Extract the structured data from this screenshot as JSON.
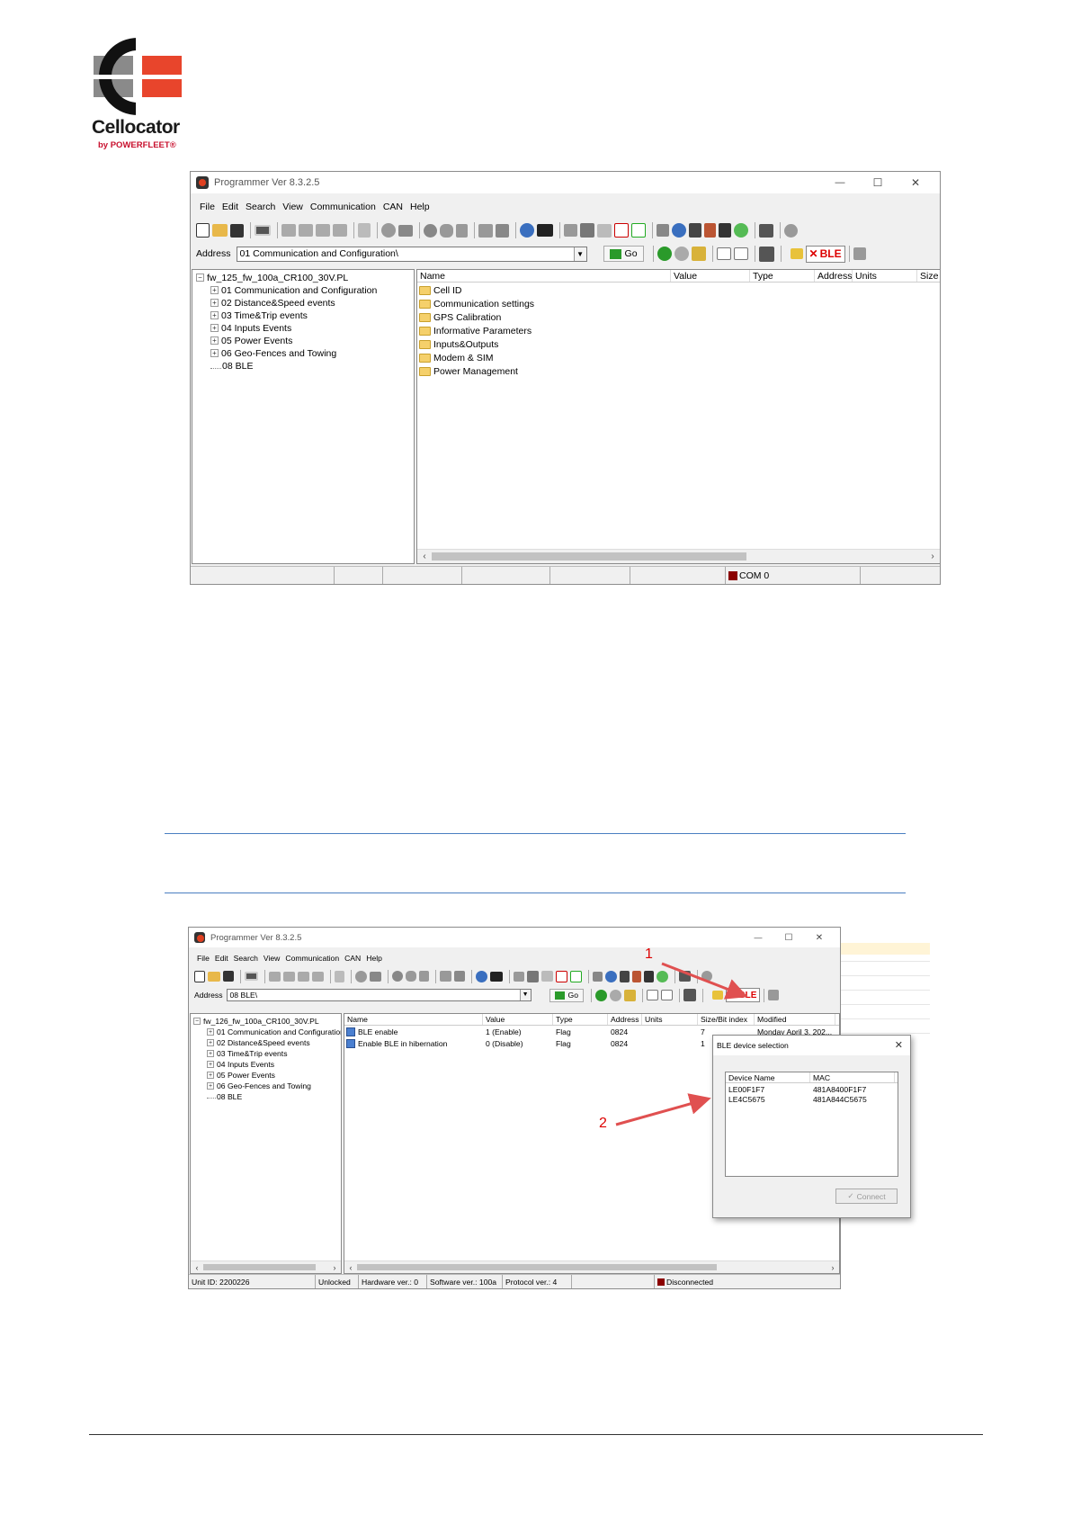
{
  "logo": {
    "word": "Cellocator",
    "byline": "by POWERFLEET®",
    "colors": {
      "dark": "#111111",
      "gray": "#8a8a8a",
      "red": "#e8452c"
    }
  },
  "window1": {
    "title": "Programmer  Ver 8.3.2.5",
    "controls": {
      "minimize": "—",
      "maximize": "☐",
      "close": "✕"
    },
    "menu": [
      "File",
      "Edit",
      "Search",
      "View",
      "Communication",
      "CAN",
      "Help"
    ],
    "address_label": "Address",
    "address_value": "01 Communication and Configuration\\",
    "go_label": "Go",
    "ble_label": "BLE",
    "tree_root": "fw_125_fw_100a_CR100_30V.PL",
    "tree_items": [
      "01 Communication and Configuration",
      "02 Distance&Speed events",
      "03 Time&Trip events",
      "04 Inputs Events",
      "05 Power Events",
      "06 Geo-Fences and Towing",
      "08 BLE"
    ],
    "columns": [
      "Name",
      "Value",
      "Type",
      "Address",
      "Units",
      "Size"
    ],
    "folders": [
      "Cell ID",
      "Communication settings",
      "GPS Calibration",
      "Informative Parameters",
      "Inputs&Outputs",
      "Modem & SIM",
      "Power Management"
    ],
    "status_com": "COM 0"
  },
  "window2": {
    "title": "Programmer  Ver 8.3.2.5",
    "controls": {
      "minimize": "—",
      "maximize": "☐",
      "close": "✕"
    },
    "menu": [
      "File",
      "Edit",
      "Search",
      "View",
      "Communication",
      "CAN",
      "Help"
    ],
    "address_label": "Address",
    "address_value": "08 BLE\\",
    "go_label": "Go",
    "ble_label": "BLE",
    "tree_root": "fw_126_fw_100a_CR100_30V.PL",
    "tree_items": [
      "01 Communication and Configuration",
      "02 Distance&Speed events",
      "03 Time&Trip events",
      "04 Inputs Events",
      "05 Power Events",
      "06 Geo-Fences and Towing",
      "08 BLE"
    ],
    "columns": [
      "Name",
      "Value",
      "Type",
      "Address",
      "Units",
      "Size/Bit index",
      "Modified"
    ],
    "rows": [
      {
        "name": "BLE enable",
        "value": "1 (Enable)",
        "type": "Flag",
        "address": "0824",
        "units": "",
        "size": "7",
        "modified": "Monday April 3, 202..."
      },
      {
        "name": "Enable BLE in hibernation",
        "value": "0 (Disable)",
        "type": "Flag",
        "address": "0824",
        "units": "",
        "size": "1",
        "modified": ""
      }
    ],
    "status": [
      "Unit ID: 2200226",
      "Unlocked",
      "Hardware ver.: 0",
      "Software ver.: 100a",
      "Protocol ver.: 4",
      "",
      "Disconnected"
    ]
  },
  "dialog": {
    "title": "BLE device selection",
    "close": "✕",
    "columns": [
      "Device Name",
      "MAC"
    ],
    "devices": [
      {
        "name": "LE00F1F7",
        "mac": "481A8400F1F7"
      },
      {
        "name": "LE4C5675",
        "mac": "481A844C5675"
      }
    ],
    "connect_label": "Connect"
  },
  "annotations": {
    "one": "1",
    "two": "2",
    "color": "#e05050"
  }
}
